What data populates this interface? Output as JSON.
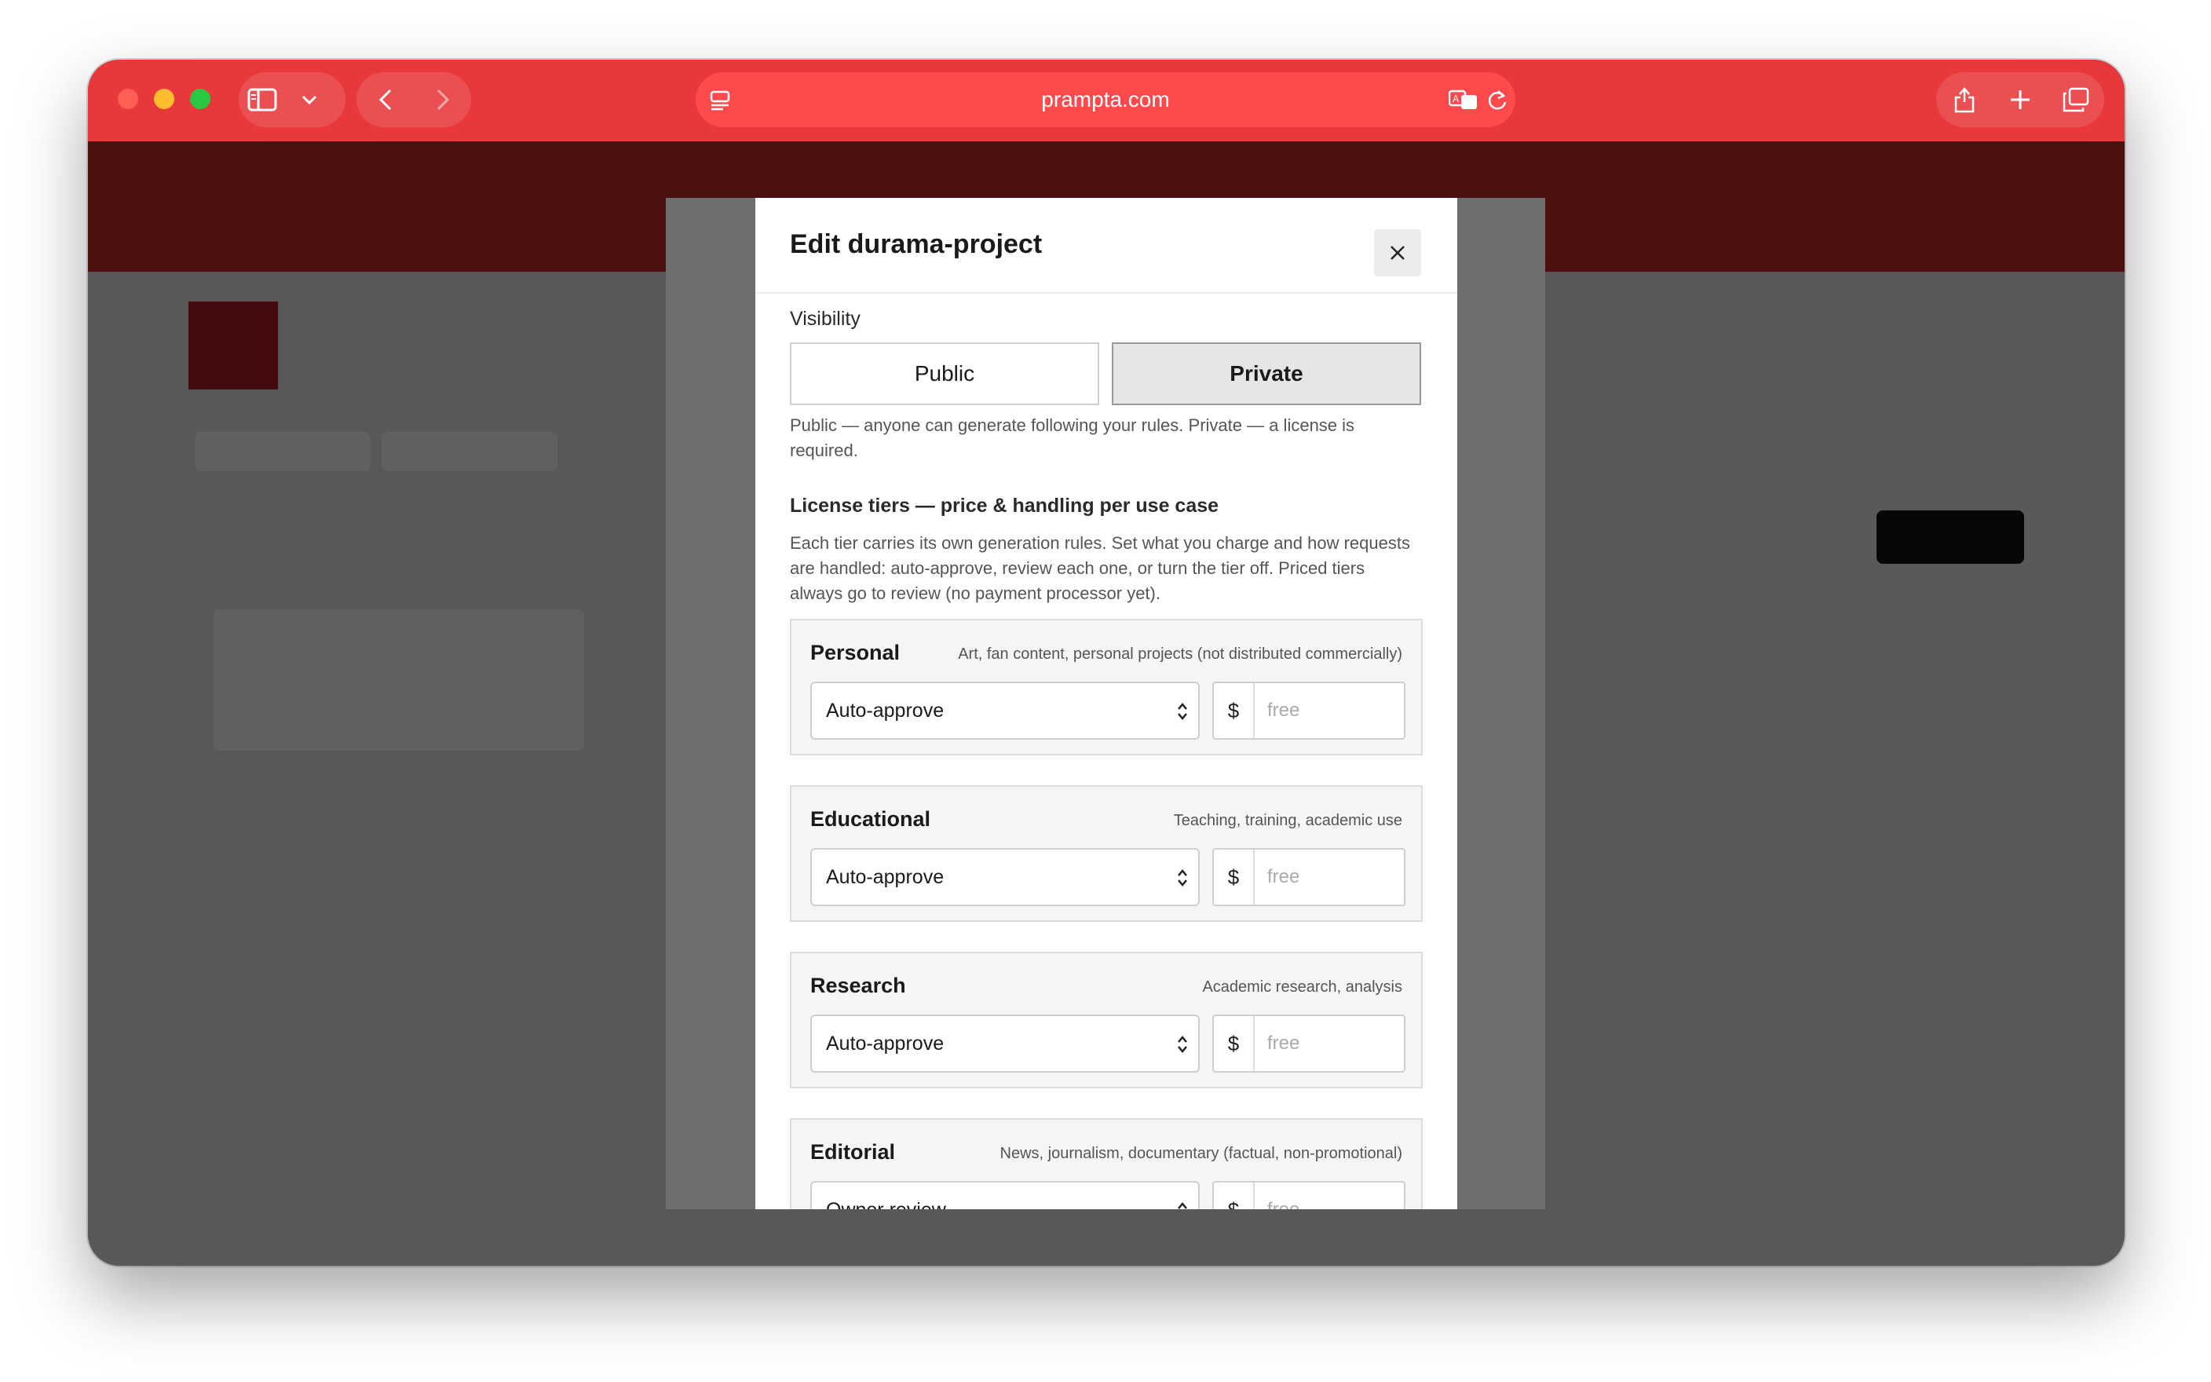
{
  "browser": {
    "url": "prampta.com"
  },
  "modal": {
    "title": "Edit durama-project",
    "visibility": {
      "label": "Visibility",
      "options": [
        "Public",
        "Private"
      ],
      "selected": "Private",
      "help": "Public — anyone can generate following your rules. Private — a license is required."
    },
    "license": {
      "heading": "License tiers — price & handling per use case",
      "help": "Each tier carries its own generation rules. Set what you charge and how requests are handled: auto-approve, review each one, or turn the tier off. Priced tiers always go to review (no payment processor yet).",
      "currency": "$",
      "price_placeholder": "free",
      "tiers": [
        {
          "name": "Personal",
          "desc": "Art, fan content, personal projects (not distributed commercially)",
          "handling": "Auto-approve"
        },
        {
          "name": "Educational",
          "desc": "Teaching, training, academic use",
          "handling": "Auto-approve"
        },
        {
          "name": "Research",
          "desc": "Academic research, analysis",
          "handling": "Auto-approve"
        },
        {
          "name": "Editorial",
          "desc": "News, journalism, documentary (factual, non-promotional)",
          "handling": "Owner review"
        }
      ]
    }
  }
}
